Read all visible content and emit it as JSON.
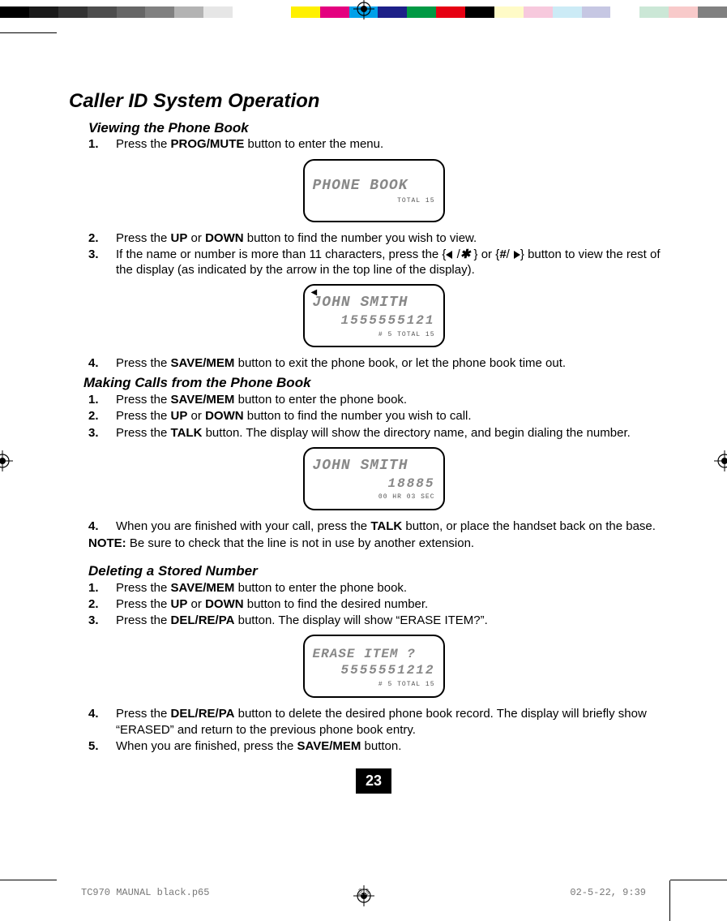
{
  "header_title": "Caller ID System Operation",
  "sections": {
    "view": {
      "title": "Viewing the Phone Book",
      "s1_pre": "Press the ",
      "s1_btn": "PROG/MUTE",
      "s1_post": " button to enter the menu.",
      "s2_pre": "Press the ",
      "s2_b1": "UP",
      "s2_mid": " or ",
      "s2_b2": "DOWN",
      "s2_post": " button to find the number you wish to view.",
      "s3_pre": "If the name or number is more than 11 characters, press the {",
      "s3_mid1": " /",
      "s3_star": "✱",
      "s3_mid2": " } or {",
      "s3_hash": "#",
      "s3_mid3": "/ ",
      "s3_post": "} button to view the rest of the display (as indicated by the arrow in the top line of the display).",
      "s4_pre": "Press the ",
      "s4_btn": "SAVE/MEM",
      "s4_post": " button to exit the phone book, or let the phone book time out."
    },
    "call": {
      "title": "Making Calls from the Phone Book",
      "s1_pre": "Press the ",
      "s1_btn": "SAVE/MEM",
      "s1_post": " button to enter the phone book.",
      "s2_pre": "Press the ",
      "s2_b1": "UP",
      "s2_mid": " or ",
      "s2_b2": "DOWN",
      "s2_post": " button to find the number you wish to call.",
      "s3_pre": "Press the ",
      "s3_btn": "TALK",
      "s3_post": " button. The display will show the directory name, and begin dialing the number.",
      "s4_pre": "When you are finished with your call, press the ",
      "s4_btn": "TALK",
      "s4_post": " button, or place the handset back on the base.",
      "note_label": "NOTE:",
      "note_text": " Be sure to check that the line is not in use by another extension."
    },
    "del": {
      "title": "Deleting a Stored Number",
      "s1_pre": "Press the ",
      "s1_btn": "SAVE/MEM",
      "s1_post": " button to enter the phone book.",
      "s2_pre": "Press the ",
      "s2_b1": "UP",
      "s2_mid": " or ",
      "s2_b2": "DOWN",
      "s2_post": " button to find the desired number.",
      "s3_pre": "Press the ",
      "s3_btn": "DEL/RE/PA",
      "s3_post": " button. The display will show “ERASE ITEM?”.",
      "s4_pre": "Press the ",
      "s4_btn": "DEL/RE/PA",
      "s4_post": " button to delete the desired phone book record. The display will briefly show “ERASED” and return to the previous phone book entry.",
      "s5_pre": "When you are finished, press the ",
      "s5_btn": "SAVE/MEM",
      "s5_post": " button."
    }
  },
  "nums": {
    "n1": "1.",
    "n2": "2.",
    "n3": "3.",
    "n4": "4.",
    "n5": "5."
  },
  "lcd1": {
    "line1": "PHONE BOOK",
    "status": "TOTAL 15"
  },
  "lcd2": {
    "line1": "JOHN SMITH",
    "line2": "1555555121",
    "status": "# 5   TOTAL 15"
  },
  "lcd3": {
    "line1": "JOHN SMITH",
    "line2": "18885",
    "status": "00 HR 03 SEC"
  },
  "lcd4": {
    "line1": "ERASE ITEM ?",
    "line2": "5555551212",
    "status": "# 5   TOTAL 15"
  },
  "page_number": "23",
  "footer": {
    "file": "TC970 MAUNAL black.p65",
    "page": "23",
    "date": "02-5-22, 9:39"
  },
  "colorbar": [
    "#000",
    "#1a1a1a",
    "#333",
    "#4d4d4d",
    "#666",
    "#808080",
    "#b3b3b3",
    "#e6e6e6",
    "#fff",
    "",
    "#fff000",
    "#e4007f",
    "#00a0e9",
    "#1d2088",
    "#009944",
    "#e60012",
    "#000",
    "#fffbc7",
    "#f7c9dd",
    "#ccebf6",
    "#c6c7e3",
    "#fff",
    "#cbe7d6",
    "#f8caca",
    "#808080"
  ]
}
